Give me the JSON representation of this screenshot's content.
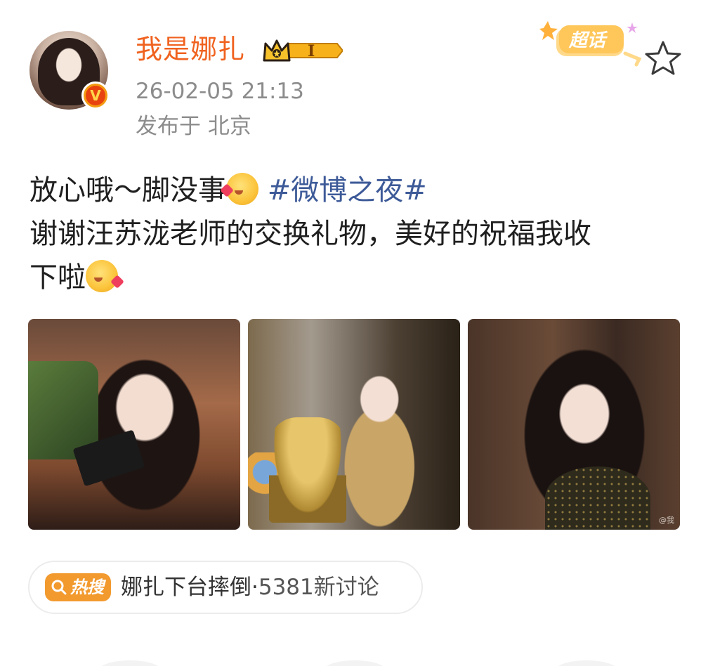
{
  "post": {
    "username": "我是娜扎",
    "level_badge": "I",
    "timestamp": "26-02-05 21:13",
    "location": "发布于 北京",
    "text_line1_before": "放心哦～脚没事",
    "hashtag": "#微博之夜#",
    "text_line2": "谢谢汪苏泷老师的交换礼物，美好的祝福我收",
    "text_line3": "下啦",
    "photo_watermark": "@我"
  },
  "header_actions": {
    "supertopic_label": "超话"
  },
  "hot_search": {
    "tag_label": "热搜",
    "topic": "娜扎下台摔倒",
    "separator": "·",
    "count": "5381新讨论"
  },
  "colors": {
    "username": "#f0621f",
    "hashtag": "#3d5a98",
    "meta": "#8c8c8c",
    "hot_tag": "#f29a2e"
  },
  "icons": {
    "verified": "verified-v-icon",
    "crown": "crown-level-icon",
    "star": "star-outline-icon",
    "emoji_1": "kiss-emoji",
    "emoji_2": "love-emoji",
    "hot_search": "search-icon"
  }
}
